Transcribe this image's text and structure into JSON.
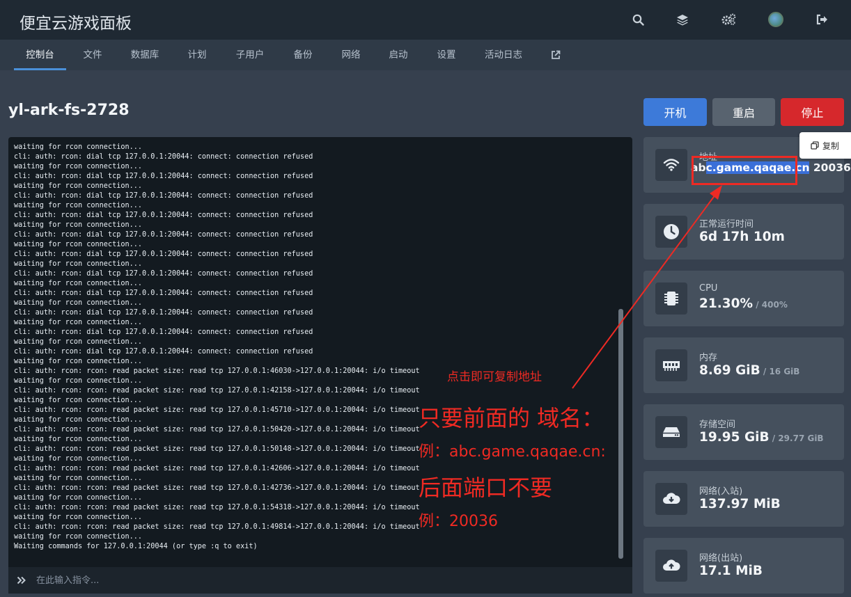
{
  "header": {
    "brand": "便宜云游戏面板",
    "icons": [
      "search-icon",
      "layers-icon",
      "cogs-icon",
      "avatar",
      "sign-out-icon"
    ]
  },
  "nav": {
    "tabs": [
      "控制台",
      "文件",
      "数据库",
      "计划",
      "子用户",
      "备份",
      "网络",
      "启动",
      "设置",
      "活动日志"
    ],
    "active": "控制台",
    "external_icon": "external-link-icon"
  },
  "server": {
    "name": "yl-ark-fs-2728"
  },
  "power": {
    "start": "开机",
    "restart": "重启",
    "stop": "停止"
  },
  "console": {
    "lines": [
      "waiting for rcon connection...",
      "cli: auth: rcon: dial tcp 127.0.0.1:20044: connect: connection refused",
      "waiting for rcon connection...",
      "cli: auth: rcon: dial tcp 127.0.0.1:20044: connect: connection refused",
      "waiting for rcon connection...",
      "cli: auth: rcon: dial tcp 127.0.0.1:20044: connect: connection refused",
      "waiting for rcon connection...",
      "cli: auth: rcon: dial tcp 127.0.0.1:20044: connect: connection refused",
      "waiting for rcon connection...",
      "cli: auth: rcon: dial tcp 127.0.0.1:20044: connect: connection refused",
      "waiting for rcon connection...",
      "cli: auth: rcon: dial tcp 127.0.0.1:20044: connect: connection refused",
      "waiting for rcon connection...",
      "cli: auth: rcon: dial tcp 127.0.0.1:20044: connect: connection refused",
      "waiting for rcon connection...",
      "cli: auth: rcon: dial tcp 127.0.0.1:20044: connect: connection refused",
      "waiting for rcon connection...",
      "cli: auth: rcon: dial tcp 127.0.0.1:20044: connect: connection refused",
      "waiting for rcon connection...",
      "cli: auth: rcon: dial tcp 127.0.0.1:20044: connect: connection refused",
      "waiting for rcon connection...",
      "cli: auth: rcon: dial tcp 127.0.0.1:20044: connect: connection refused",
      "waiting for rcon connection...",
      "cli: auth: rcon: rcon: read packet size: read tcp 127.0.0.1:46030->127.0.0.1:20044: i/o timeout",
      "waiting for rcon connection...",
      "cli: auth: rcon: rcon: read packet size: read tcp 127.0.0.1:42158->127.0.0.1:20044: i/o timeout",
      "waiting for rcon connection...",
      "cli: auth: rcon: rcon: read packet size: read tcp 127.0.0.1:45710->127.0.0.1:20044: i/o timeout",
      "waiting for rcon connection...",
      "cli: auth: rcon: rcon: read packet size: read tcp 127.0.0.1:50420->127.0.0.1:20044: i/o timeout",
      "waiting for rcon connection...",
      "cli: auth: rcon: rcon: read packet size: read tcp 127.0.0.1:50148->127.0.0.1:20044: i/o timeout",
      "waiting for rcon connection...",
      "cli: auth: rcon: rcon: read packet size: read tcp 127.0.0.1:42606->127.0.0.1:20044: i/o timeout",
      "waiting for rcon connection...",
      "cli: auth: rcon: rcon: read packet size: read tcp 127.0.0.1:42736->127.0.0.1:20044: i/o timeout",
      "waiting for rcon connection...",
      "cli: auth: rcon: rcon: read packet size: read tcp 127.0.0.1:54318->127.0.0.1:20044: i/o timeout",
      "waiting for rcon connection...",
      "cli: auth: rcon: rcon: read packet size: read tcp 127.0.0.1:49814->127.0.0.1:20044: i/o timeout",
      "waiting for rcon connection...",
      "Waiting commands for 127.0.0.1:20044 (or type :q to exit)"
    ],
    "prompt_icon": "double-chevron-right-icon",
    "input_placeholder": "在此输入指令..."
  },
  "stats": {
    "address": {
      "label": "地址",
      "host_prefix": "ab",
      "host_selected": "c.game.qaqae.cn",
      "port": " 20036",
      "icon": "wifi-icon"
    },
    "uptime": {
      "label": "正常运行时间",
      "value": "6d 17h 10m",
      "icon": "clock-icon"
    },
    "cpu": {
      "label": "CPU",
      "value": "21.30%",
      "limit": " / 400%",
      "icon": "chip-icon"
    },
    "memory": {
      "label": "内存",
      "value": "8.69 GiB",
      "limit": " / 16 GiB",
      "icon": "memory-icon"
    },
    "storage": {
      "label": "存储空间",
      "value": "19.95 GiB",
      "limit": " / 29.77 GiB",
      "icon": "hdd-icon"
    },
    "net_in": {
      "label": "网络(入站)",
      "value": "137.97 MiB",
      "icon": "cloud-download-icon"
    },
    "net_out": {
      "label": "网络(出站)",
      "value": "17.1 MiB",
      "icon": "cloud-upload-icon"
    }
  },
  "copy_tooltip": {
    "label": "复制",
    "icon": "copy-icon"
  },
  "annotations": {
    "click_hint": "点击即可复制地址",
    "line1": "只要前面的 域名：",
    "line2": "例：abc.game.qaqae.cn:",
    "line3": "后面端口不要",
    "line4": "例：20036",
    "color": "#ef2a23"
  }
}
